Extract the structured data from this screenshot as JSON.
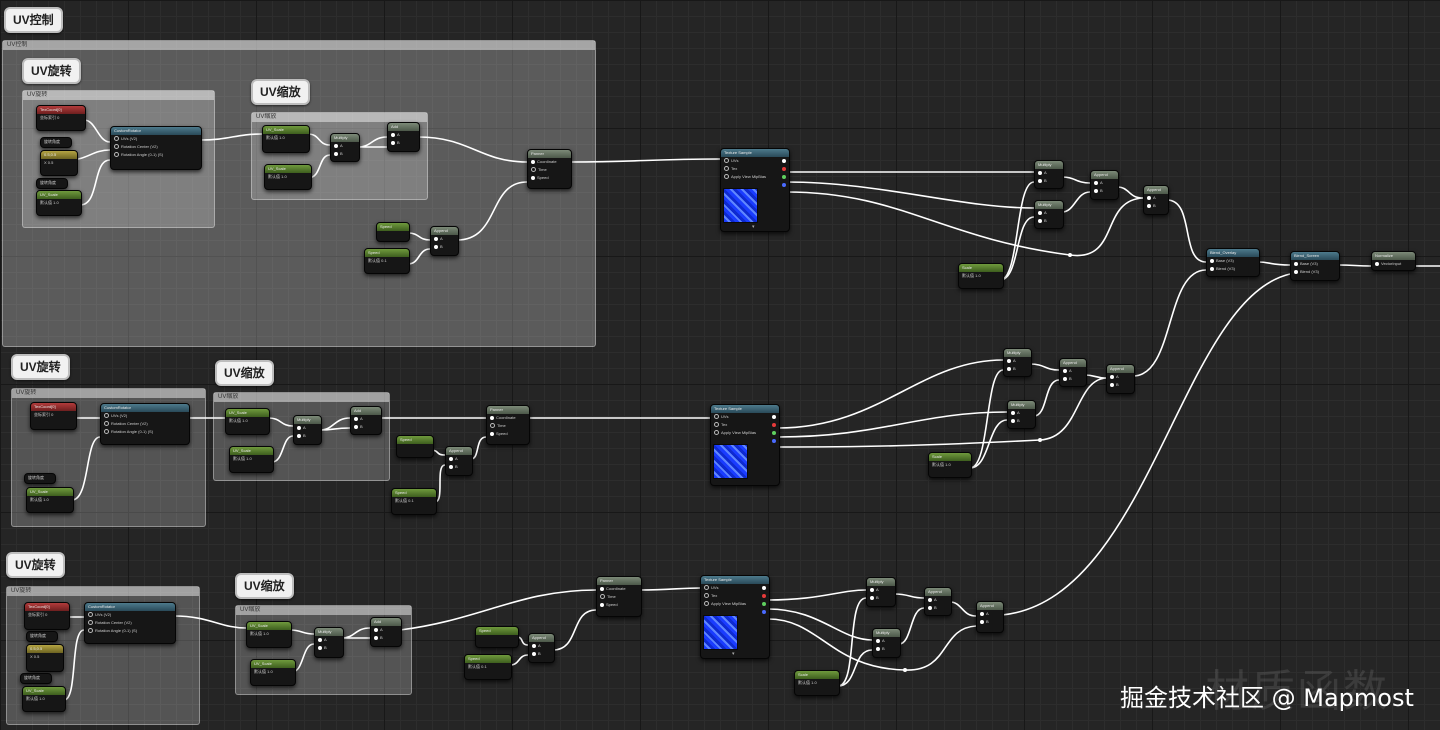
{
  "app": "Material Graph Editor",
  "groups": {
    "uv_control": {
      "bubble": "UV控制",
      "header": "UV控制"
    },
    "block1": {
      "rotate": {
        "bubble": "UV旋转",
        "header": "UV旋转"
      },
      "scale": {
        "bubble": "UV缩放",
        "header": "UV缩放"
      }
    },
    "block2": {
      "rotate": {
        "bubble": "UV旋转",
        "header": "UV旋转"
      },
      "scale": {
        "bubble": "UV缩放",
        "header": "UV缩放"
      }
    },
    "block3": {
      "rotate": {
        "bubble": "UV旋转",
        "header": "UV旋转"
      },
      "scale": {
        "bubble": "UV缩放",
        "header": "UV缩放"
      }
    }
  },
  "nodes": {
    "texcoord": {
      "title": "TexCoord[0]",
      "row": "坐标索引 0"
    },
    "rotator": {
      "title": "CustomRotator",
      "in1": "UVs (V2)",
      "in2": "Rotation Center (V2)",
      "in3": "Rotation Angle (0-1) (S)",
      "out": "Rotated Values"
    },
    "rotation_param": {
      "title": "旋转角度"
    },
    "center_vec": {
      "title": "0.5,0.5",
      "row": "X 0.5"
    },
    "scale_param": {
      "title": "UV_Scale",
      "row": "默认值 1.0"
    },
    "multiply": {
      "title": "Multiply",
      "a": "A",
      "b": "B"
    },
    "add": {
      "title": "Add",
      "a": "A",
      "b": "B"
    },
    "append": {
      "title": "Append",
      "a": "A",
      "b": "B"
    },
    "panner": {
      "title": "Panner",
      "coordinate": "Coordinate",
      "time": "Time",
      "speed": "Speed"
    },
    "speed_param": {
      "title": "Speed",
      "row": "默认值 0.1"
    },
    "texture_sample": {
      "title": "Texture Sample",
      "uvs": "UVs",
      "tex": "Tex",
      "mip": "Apply View MipBias",
      "rgb": "RGB",
      "r": "R",
      "g": "G",
      "b": "B",
      "a": "A",
      "rgba": "RGBA"
    },
    "const_param": {
      "title": "Scale",
      "row": "默认值 1.0"
    },
    "blend_overlay": {
      "title": "Blend_Overlay",
      "base": "Base (V3)",
      "blend": "Blend (V3)",
      "result": "Result"
    },
    "blend_screen": {
      "title": "Blend_Screen",
      "base": "Base (V3)",
      "blend": "Blend (V3)",
      "result": "Result"
    },
    "normalize": {
      "title": "Normalize",
      "out": "VectorInput"
    }
  },
  "watermark": {
    "title": "材质函数",
    "credit": "掘金技术社区 @ Mapmost"
  },
  "colors": {
    "background": "#252525",
    "wire": "#ffffff",
    "param_header": "#6f9a3d",
    "func_header": "#4d7a8c",
    "texture_blue": "#2547ff"
  }
}
